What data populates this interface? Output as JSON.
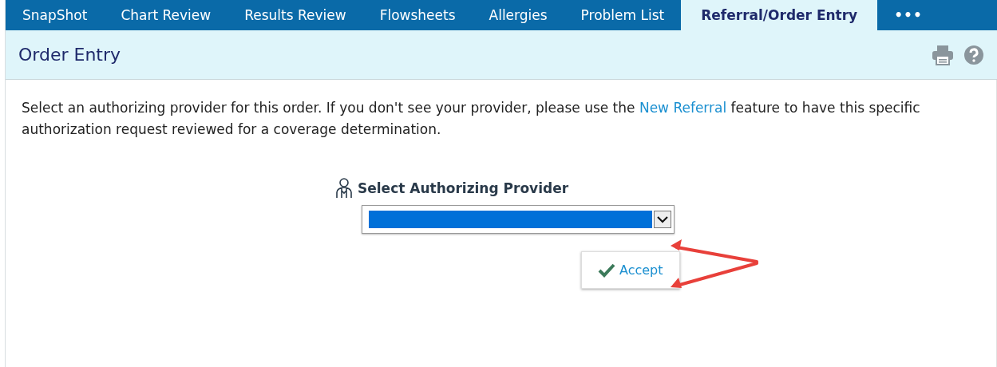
{
  "tabs": [
    {
      "label": "SnapShot",
      "selected": false
    },
    {
      "label": "Chart Review",
      "selected": false
    },
    {
      "label": "Results Review",
      "selected": false
    },
    {
      "label": "Flowsheets",
      "selected": false
    },
    {
      "label": "Allergies",
      "selected": false
    },
    {
      "label": "Problem List",
      "selected": false
    },
    {
      "label": "Referral/Order Entry",
      "selected": true
    },
    {
      "label": "•••",
      "selected": false
    }
  ],
  "header": {
    "title": "Order Entry"
  },
  "instructions": {
    "text_before": "Select an authorizing provider for this order. If you don't see your provider, please use the ",
    "link": "New Referral",
    "text_after": " feature to have this specific authorization request reviewed for a coverage determination."
  },
  "provider_select": {
    "label": "Select Authorizing Provider",
    "highlighted": true
  },
  "accept_button": {
    "label": "Accept"
  }
}
